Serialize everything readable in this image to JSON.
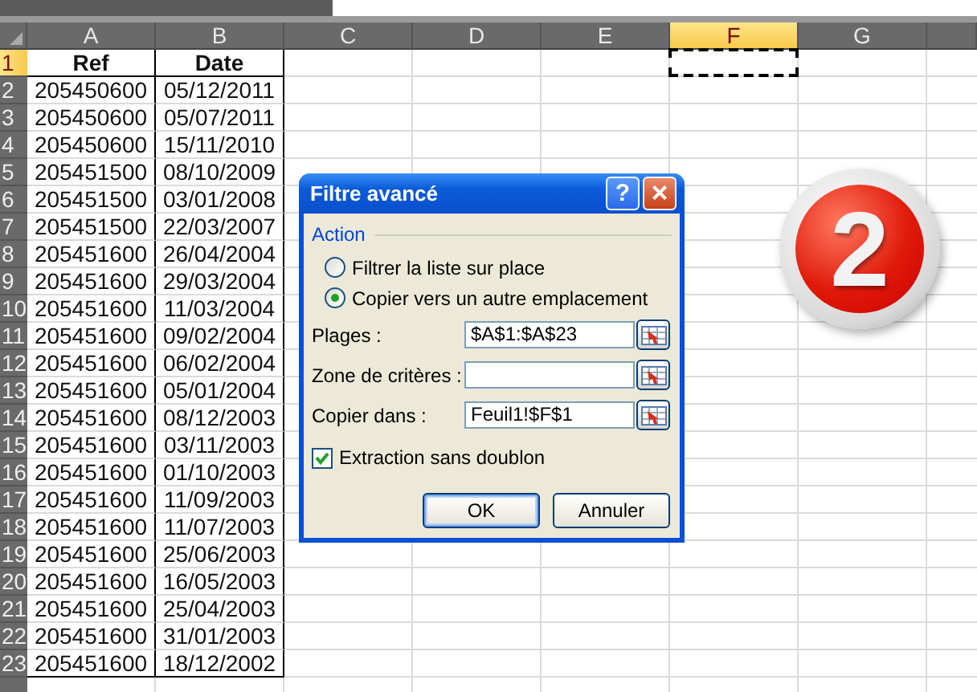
{
  "columns": [
    {
      "label": "A",
      "selected": false
    },
    {
      "label": "B",
      "selected": false
    },
    {
      "label": "C",
      "selected": false
    },
    {
      "label": "D",
      "selected": false
    },
    {
      "label": "E",
      "selected": false
    },
    {
      "label": "F",
      "selected": true
    },
    {
      "label": "G",
      "selected": false
    },
    {
      "selected": false
    }
  ],
  "rows": [
    {
      "num": "1",
      "selected": true,
      "kind": "header",
      "cells": [
        "Ref",
        "Date"
      ]
    },
    {
      "num": "2",
      "selected": false,
      "kind": "data",
      "cells": [
        "205450600",
        "05/12/2011"
      ]
    },
    {
      "num": "3",
      "selected": false,
      "kind": "data",
      "cells": [
        "205450600",
        "05/07/2011"
      ]
    },
    {
      "num": "4",
      "selected": false,
      "kind": "data",
      "cells": [
        "205450600",
        "15/11/2010"
      ]
    },
    {
      "num": "5",
      "selected": false,
      "kind": "data",
      "cells": [
        "205451500",
        "08/10/2009"
      ]
    },
    {
      "num": "6",
      "selected": false,
      "kind": "data",
      "cells": [
        "205451500",
        "03/01/2008"
      ]
    },
    {
      "num": "7",
      "selected": false,
      "kind": "data",
      "cells": [
        "205451500",
        "22/03/2007"
      ]
    },
    {
      "num": "8",
      "selected": false,
      "kind": "data",
      "cells": [
        "205451600",
        "26/04/2004"
      ]
    },
    {
      "num": "9",
      "selected": false,
      "kind": "data",
      "cells": [
        "205451600",
        "29/03/2004"
      ]
    },
    {
      "num": "10",
      "selected": false,
      "kind": "data",
      "cells": [
        "205451600",
        "11/03/2004"
      ]
    },
    {
      "num": "11",
      "selected": false,
      "kind": "data",
      "cells": [
        "205451600",
        "09/02/2004"
      ]
    },
    {
      "num": "12",
      "selected": false,
      "kind": "data",
      "cells": [
        "205451600",
        "06/02/2004"
      ]
    },
    {
      "num": "13",
      "selected": false,
      "kind": "data",
      "cells": [
        "205451600",
        "05/01/2004"
      ]
    },
    {
      "num": "14",
      "selected": false,
      "kind": "data",
      "cells": [
        "205451600",
        "08/12/2003"
      ]
    },
    {
      "num": "15",
      "selected": false,
      "kind": "data",
      "cells": [
        "205451600",
        "03/11/2003"
      ]
    },
    {
      "num": "16",
      "selected": false,
      "kind": "data",
      "cells": [
        "205451600",
        "01/10/2003"
      ]
    },
    {
      "num": "17",
      "selected": false,
      "kind": "data",
      "cells": [
        "205451600",
        "11/09/2003"
      ]
    },
    {
      "num": "18",
      "selected": false,
      "kind": "data",
      "cells": [
        "205451600",
        "11/07/2003"
      ]
    },
    {
      "num": "19",
      "selected": false,
      "kind": "data",
      "cells": [
        "205451600",
        "25/06/2003"
      ]
    },
    {
      "num": "20",
      "selected": false,
      "kind": "data",
      "cells": [
        "205451600",
        "16/05/2003"
      ]
    },
    {
      "num": "21",
      "selected": false,
      "kind": "data",
      "cells": [
        "205451600",
        "25/04/2003"
      ]
    },
    {
      "num": "22",
      "selected": false,
      "kind": "data",
      "cells": [
        "205451600",
        "31/01/2003"
      ]
    },
    {
      "num": "23",
      "selected": false,
      "kind": "data",
      "cells": [
        "205451600",
        "18/12/2002"
      ]
    }
  ],
  "dialog": {
    "title": "Filtre avancé",
    "help": "?",
    "close": "×",
    "group": "Action",
    "options": [
      {
        "label": "Filtrer la liste sur place",
        "selected": false
      },
      {
        "label": "Copier vers un autre emplacement",
        "selected": true
      }
    ],
    "fields": [
      {
        "label": "Plages :",
        "value": "$A$1:$A$23"
      },
      {
        "label": "Zone de critères :"
      },
      {
        "label": "Copier dans :",
        "value": "Feuil1!$F$1"
      }
    ],
    "checkbox": {
      "label": "Extraction sans doublon",
      "checked": true
    },
    "buttons": [
      {
        "label": "OK",
        "default": true
      },
      {
        "label": "Annuler",
        "default": false
      }
    ]
  },
  "badge": "2"
}
